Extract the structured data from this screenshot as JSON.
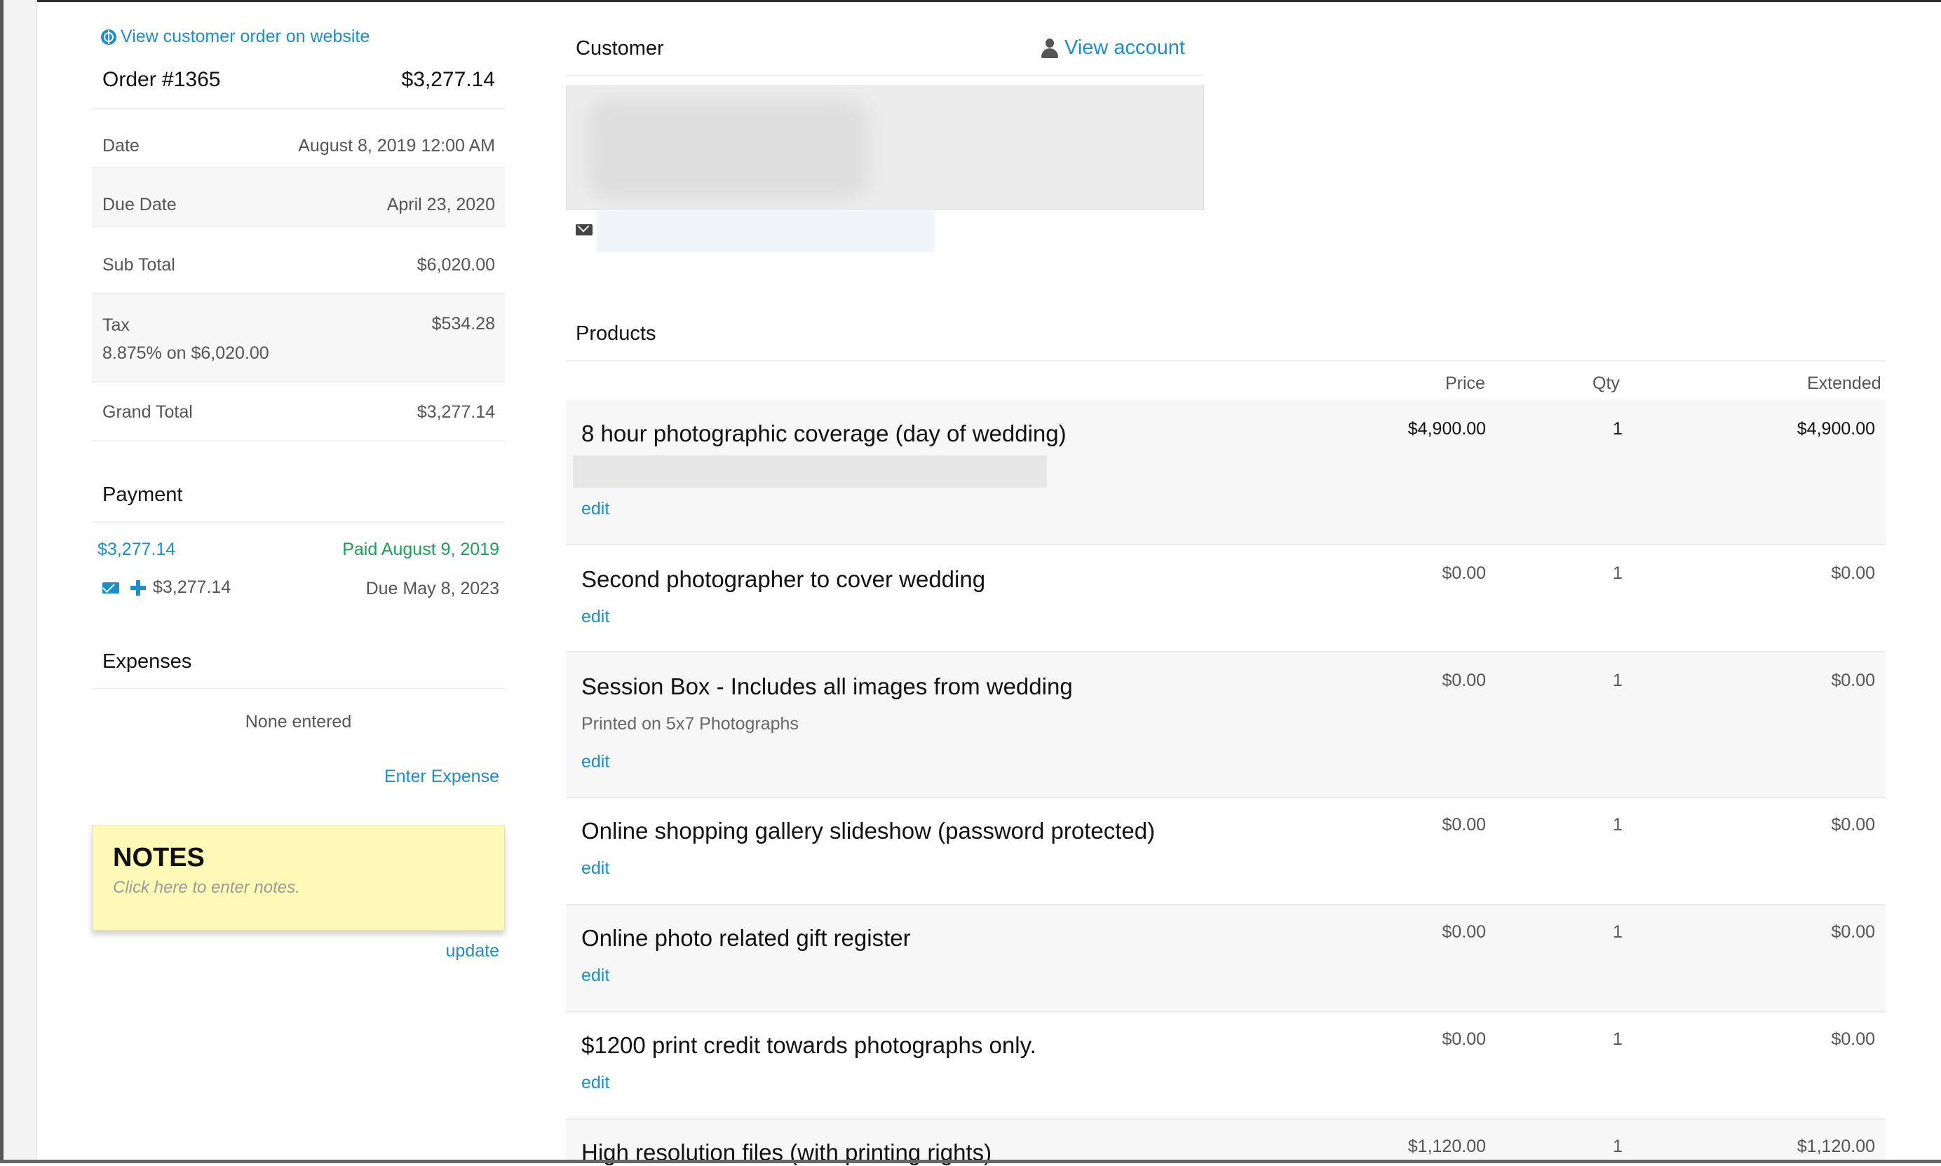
{
  "website_link": "View customer order on website",
  "order": {
    "number_label": "Order #1365",
    "total": "$3,277.14",
    "summary": [
      {
        "label": "Date",
        "value": "August 8, 2019 12:00 AM"
      },
      {
        "label": "Due Date",
        "value": "April 23, 2020"
      },
      {
        "label": "Sub Total",
        "value": "$6,020.00"
      },
      {
        "label": "Tax",
        "value": "$534.28",
        "sub": "8.875% on $6,020.00"
      },
      {
        "label": "Grand Total",
        "value": "$3,277.14"
      }
    ]
  },
  "payment": {
    "title": "Payment",
    "amount": "$3,277.14",
    "status": "Paid August 9, 2019",
    "pending_amount": "$3,277.14",
    "pending_due": "Due May 8, 2023"
  },
  "expenses": {
    "title": "Expenses",
    "empty_text": "None entered",
    "enter_label": "Enter Expense"
  },
  "notes": {
    "title": "NOTES",
    "placeholder": "Click here to enter notes.",
    "update_label": "update"
  },
  "customer": {
    "title": "Customer",
    "view_account": "View account"
  },
  "products": {
    "title": "Products",
    "columns": {
      "price": "Price",
      "qty": "Qty",
      "extended": "Extended"
    },
    "edit_label": "edit",
    "items": [
      {
        "name": "8 hour photographic coverage (day of wedding)",
        "price": "$4,900.00",
        "qty": "1",
        "extended": "$4,900.00"
      },
      {
        "name": "Second photographer to cover wedding",
        "price": "$0.00",
        "qty": "1",
        "extended": "$0.00"
      },
      {
        "name": "Session Box - Includes all images from wedding",
        "description": "Printed on 5x7 Photographs",
        "price": "$0.00",
        "qty": "1",
        "extended": "$0.00"
      },
      {
        "name": "Online shopping gallery slideshow (password protected)",
        "price": "$0.00",
        "qty": "1",
        "extended": "$0.00"
      },
      {
        "name": "Online photo related gift register",
        "price": "$0.00",
        "qty": "1",
        "extended": "$0.00"
      },
      {
        "name": "$1200 print credit towards photographs only.",
        "price": "$0.00",
        "qty": "1",
        "extended": "$0.00"
      },
      {
        "name": "High resolution files (with printing rights)",
        "price": "$1,120.00",
        "qty": "1",
        "extended": "$1,120.00"
      }
    ]
  },
  "colors": {
    "link": "#1a8fc9",
    "paid": "#1e9e57",
    "notes_bg": "#fff9b8"
  }
}
